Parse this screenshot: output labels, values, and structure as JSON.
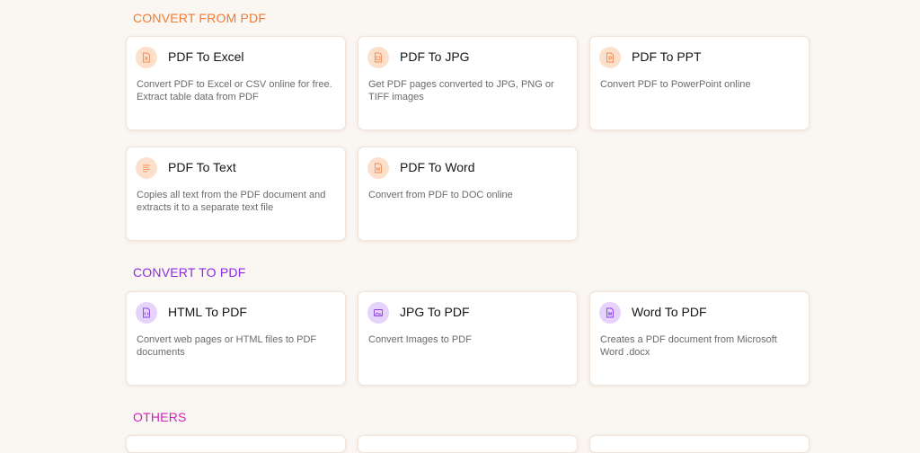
{
  "sections": [
    {
      "title": "CONVERT FROM PDF",
      "color": "#f47a30",
      "cards": [
        {
          "title": "PDF To Excel",
          "description": "Convert PDF to Excel or CSV online for free. Extract table data from PDF",
          "icon": "excel-file-icon"
        },
        {
          "title": "PDF To JPG",
          "description": "Get PDF pages converted to JPG, PNG or TIFF images",
          "icon": "image-file-icon"
        },
        {
          "title": "PDF To PPT",
          "description": "Convert PDF to PowerPoint online",
          "icon": "ppt-file-icon"
        },
        {
          "title": "PDF To Text",
          "description": "Copies all text from the PDF document and extracts it to a separate text file",
          "icon": "text-lines-icon"
        },
        {
          "title": "PDF To Word",
          "description": "Convert from PDF to DOC online",
          "icon": "word-file-icon"
        }
      ]
    },
    {
      "title": "CONVERT TO PDF",
      "color": "#8a2be2",
      "cards": [
        {
          "title": "HTML To PDF",
          "description": "Convert web pages or HTML files to PDF documents",
          "icon": "html-file-icon"
        },
        {
          "title": "JPG To PDF",
          "description": "Convert Images to PDF",
          "icon": "image-icon"
        },
        {
          "title": "Word To PDF",
          "description": "Creates a PDF document from Microsoft Word .docx",
          "icon": "word-file-icon"
        }
      ]
    },
    {
      "title": "OTHERS",
      "color": "#d61fbf",
      "cards": []
    }
  ],
  "colors": {
    "orange_icon": "#f28a55",
    "purple_icon": "#8b3fe0",
    "background": "#faf6f2"
  }
}
